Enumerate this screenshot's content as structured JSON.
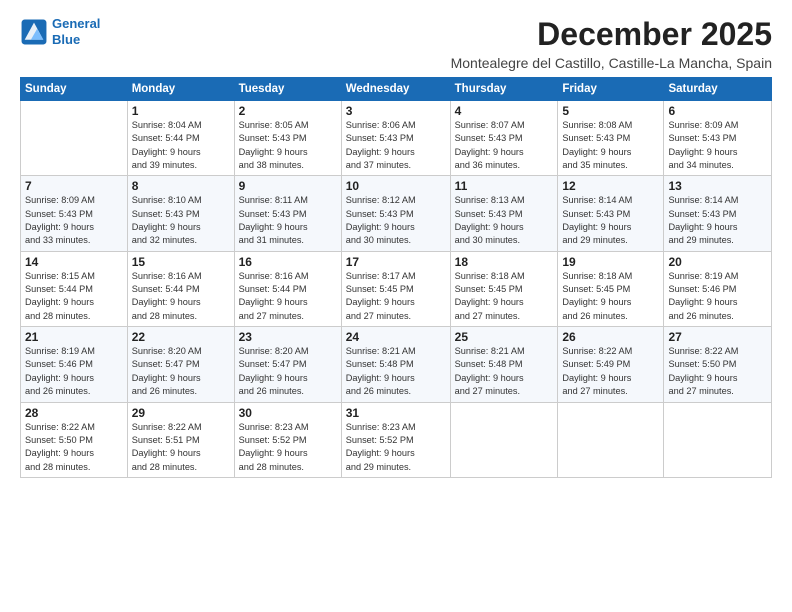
{
  "header": {
    "logo_line1": "General",
    "logo_line2": "Blue",
    "month_title": "December 2025",
    "subtitle": "Montealegre del Castillo, Castille-La Mancha, Spain"
  },
  "weekdays": [
    "Sunday",
    "Monday",
    "Tuesday",
    "Wednesday",
    "Thursday",
    "Friday",
    "Saturday"
  ],
  "weeks": [
    [
      {
        "day": "",
        "info": ""
      },
      {
        "day": "1",
        "info": "Sunrise: 8:04 AM\nSunset: 5:44 PM\nDaylight: 9 hours\nand 39 minutes."
      },
      {
        "day": "2",
        "info": "Sunrise: 8:05 AM\nSunset: 5:43 PM\nDaylight: 9 hours\nand 38 minutes."
      },
      {
        "day": "3",
        "info": "Sunrise: 8:06 AM\nSunset: 5:43 PM\nDaylight: 9 hours\nand 37 minutes."
      },
      {
        "day": "4",
        "info": "Sunrise: 8:07 AM\nSunset: 5:43 PM\nDaylight: 9 hours\nand 36 minutes."
      },
      {
        "day": "5",
        "info": "Sunrise: 8:08 AM\nSunset: 5:43 PM\nDaylight: 9 hours\nand 35 minutes."
      },
      {
        "day": "6",
        "info": "Sunrise: 8:09 AM\nSunset: 5:43 PM\nDaylight: 9 hours\nand 34 minutes."
      }
    ],
    [
      {
        "day": "7",
        "info": "Sunrise: 8:09 AM\nSunset: 5:43 PM\nDaylight: 9 hours\nand 33 minutes."
      },
      {
        "day": "8",
        "info": "Sunrise: 8:10 AM\nSunset: 5:43 PM\nDaylight: 9 hours\nand 32 minutes."
      },
      {
        "day": "9",
        "info": "Sunrise: 8:11 AM\nSunset: 5:43 PM\nDaylight: 9 hours\nand 31 minutes."
      },
      {
        "day": "10",
        "info": "Sunrise: 8:12 AM\nSunset: 5:43 PM\nDaylight: 9 hours\nand 30 minutes."
      },
      {
        "day": "11",
        "info": "Sunrise: 8:13 AM\nSunset: 5:43 PM\nDaylight: 9 hours\nand 30 minutes."
      },
      {
        "day": "12",
        "info": "Sunrise: 8:14 AM\nSunset: 5:43 PM\nDaylight: 9 hours\nand 29 minutes."
      },
      {
        "day": "13",
        "info": "Sunrise: 8:14 AM\nSunset: 5:43 PM\nDaylight: 9 hours\nand 29 minutes."
      }
    ],
    [
      {
        "day": "14",
        "info": "Sunrise: 8:15 AM\nSunset: 5:44 PM\nDaylight: 9 hours\nand 28 minutes."
      },
      {
        "day": "15",
        "info": "Sunrise: 8:16 AM\nSunset: 5:44 PM\nDaylight: 9 hours\nand 28 minutes."
      },
      {
        "day": "16",
        "info": "Sunrise: 8:16 AM\nSunset: 5:44 PM\nDaylight: 9 hours\nand 27 minutes."
      },
      {
        "day": "17",
        "info": "Sunrise: 8:17 AM\nSunset: 5:45 PM\nDaylight: 9 hours\nand 27 minutes."
      },
      {
        "day": "18",
        "info": "Sunrise: 8:18 AM\nSunset: 5:45 PM\nDaylight: 9 hours\nand 27 minutes."
      },
      {
        "day": "19",
        "info": "Sunrise: 8:18 AM\nSunset: 5:45 PM\nDaylight: 9 hours\nand 26 minutes."
      },
      {
        "day": "20",
        "info": "Sunrise: 8:19 AM\nSunset: 5:46 PM\nDaylight: 9 hours\nand 26 minutes."
      }
    ],
    [
      {
        "day": "21",
        "info": "Sunrise: 8:19 AM\nSunset: 5:46 PM\nDaylight: 9 hours\nand 26 minutes."
      },
      {
        "day": "22",
        "info": "Sunrise: 8:20 AM\nSunset: 5:47 PM\nDaylight: 9 hours\nand 26 minutes."
      },
      {
        "day": "23",
        "info": "Sunrise: 8:20 AM\nSunset: 5:47 PM\nDaylight: 9 hours\nand 26 minutes."
      },
      {
        "day": "24",
        "info": "Sunrise: 8:21 AM\nSunset: 5:48 PM\nDaylight: 9 hours\nand 26 minutes."
      },
      {
        "day": "25",
        "info": "Sunrise: 8:21 AM\nSunset: 5:48 PM\nDaylight: 9 hours\nand 27 minutes."
      },
      {
        "day": "26",
        "info": "Sunrise: 8:22 AM\nSunset: 5:49 PM\nDaylight: 9 hours\nand 27 minutes."
      },
      {
        "day": "27",
        "info": "Sunrise: 8:22 AM\nSunset: 5:50 PM\nDaylight: 9 hours\nand 27 minutes."
      }
    ],
    [
      {
        "day": "28",
        "info": "Sunrise: 8:22 AM\nSunset: 5:50 PM\nDaylight: 9 hours\nand 28 minutes."
      },
      {
        "day": "29",
        "info": "Sunrise: 8:22 AM\nSunset: 5:51 PM\nDaylight: 9 hours\nand 28 minutes."
      },
      {
        "day": "30",
        "info": "Sunrise: 8:23 AM\nSunset: 5:52 PM\nDaylight: 9 hours\nand 28 minutes."
      },
      {
        "day": "31",
        "info": "Sunrise: 8:23 AM\nSunset: 5:52 PM\nDaylight: 9 hours\nand 29 minutes."
      },
      {
        "day": "",
        "info": ""
      },
      {
        "day": "",
        "info": ""
      },
      {
        "day": "",
        "info": ""
      }
    ]
  ]
}
